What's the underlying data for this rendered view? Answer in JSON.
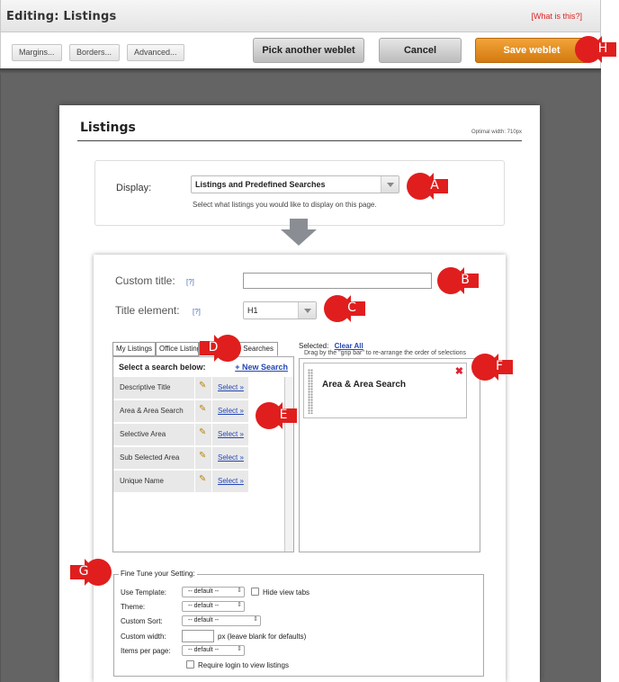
{
  "header": {
    "title": "Editing: Listings",
    "help_link": "[What is this?]"
  },
  "toolbar": {
    "margins_label": "Margins...",
    "borders_label": "Borders...",
    "advanced_label": "Advanced...",
    "pick_label": "Pick another weblet",
    "cancel_label": "Cancel",
    "save_label": "Save weblet"
  },
  "panel": {
    "title": "Listings",
    "optimal_width": "Optimal width: 710px"
  },
  "display": {
    "label": "Display:",
    "selected": "Listings and Predefined Searches",
    "help": "Select what listings you would like to display on this page."
  },
  "config": {
    "custom_title_label": "Custom title:",
    "custom_title_help": "[?]",
    "custom_title_value": "",
    "title_element_label": "Title element:",
    "title_element_help": "[?]",
    "title_element_value": "H1"
  },
  "tabs": [
    {
      "label": "My Listings"
    },
    {
      "label": "Office Listings"
    },
    {
      "label": "Searches"
    }
  ],
  "search_list": {
    "heading": "Select a search below:",
    "new_search": "+ New Search",
    "items": [
      {
        "name": "Descriptive Title",
        "select": "Select »"
      },
      {
        "name": "Area & Area Search",
        "select": "Select »"
      },
      {
        "name": "Selective Area",
        "select": "Select »"
      },
      {
        "name": "Sub Selected Area",
        "select": "Select »"
      },
      {
        "name": "Unique Name",
        "select": "Select »"
      }
    ]
  },
  "selected": {
    "label": "Selected:",
    "clear_all": "Clear All",
    "drag_note": "Drag by the \"grip bar\" to re-arrange the order of selections",
    "items": [
      {
        "label": "Area & Area Search"
      }
    ]
  },
  "fine_tune": {
    "legend": "Fine Tune your Setting:",
    "use_template_label": "Use Template:",
    "use_template_value": "-- default --",
    "hide_view_tabs": "Hide view tabs",
    "theme_label": "Theme:",
    "theme_value": "-- default --",
    "custom_sort_label": "Custom Sort:",
    "custom_sort_value": "-- default --",
    "custom_width_label": "Custom width:",
    "custom_width_hint": "px (leave blank for defaults)",
    "items_per_page_label": "Items per page:",
    "items_per_page_value": "-- default --",
    "require_login": "Require login to view listings"
  },
  "annotations": {
    "A": "A",
    "B": "B",
    "C": "C",
    "D": "D",
    "E": "E",
    "F": "F",
    "G": "G",
    "H": "H"
  },
  "colors": {
    "accent_orange": "#e08a1e",
    "marker_red": "#e01e1e",
    "link_blue": "#2347b6",
    "workarea_grey": "#646464"
  }
}
